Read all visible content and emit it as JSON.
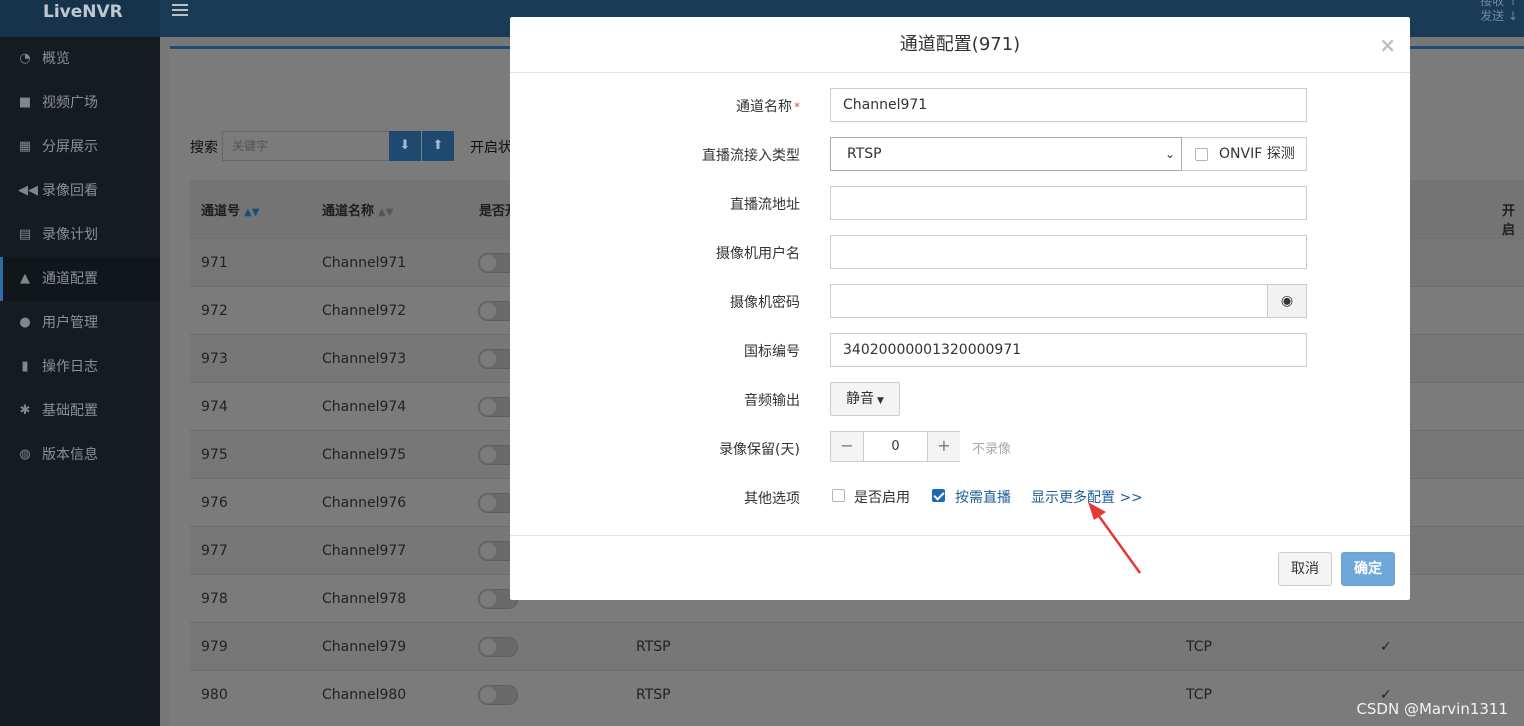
{
  "app": {
    "brand": "LiveNVR",
    "net_recv": "接收",
    "net_send": "发送"
  },
  "sidebar": {
    "items": [
      {
        "label": "概览",
        "icon": "dashboard-icon"
      },
      {
        "label": "视频广场",
        "icon": "video-camera-icon"
      },
      {
        "label": "分屏展示",
        "icon": "grid-icon"
      },
      {
        "label": "录像回看",
        "icon": "rewind-icon"
      },
      {
        "label": "录像计划",
        "icon": "calendar-icon"
      },
      {
        "label": "通道配置",
        "icon": "road-icon",
        "active": true
      },
      {
        "label": "用户管理",
        "icon": "users-icon"
      },
      {
        "label": "操作日志",
        "icon": "file-icon"
      },
      {
        "label": "基础配置",
        "icon": "gears-icon"
      },
      {
        "label": "版本信息",
        "icon": "globe-icon"
      }
    ]
  },
  "toolbar": {
    "search_label": "搜索",
    "search_placeholder": "关键字",
    "filter_label": "开启状态"
  },
  "table": {
    "headers": [
      "通道号",
      "通道名称",
      "是否开",
      "开启"
    ],
    "rows": [
      {
        "id": "971",
        "name": "Channel971",
        "proto": "",
        "transport": "",
        "check": ""
      },
      {
        "id": "972",
        "name": "Channel972",
        "proto": "",
        "transport": "",
        "check": ""
      },
      {
        "id": "973",
        "name": "Channel973",
        "proto": "",
        "transport": "",
        "check": ""
      },
      {
        "id": "974",
        "name": "Channel974",
        "proto": "",
        "transport": "",
        "check": ""
      },
      {
        "id": "975",
        "name": "Channel975",
        "proto": "",
        "transport": "",
        "check": ""
      },
      {
        "id": "976",
        "name": "Channel976",
        "proto": "",
        "transport": "",
        "check": ""
      },
      {
        "id": "977",
        "name": "Channel977",
        "proto": "",
        "transport": "",
        "check": ""
      },
      {
        "id": "978",
        "name": "Channel978",
        "proto": "",
        "transport": "",
        "check": ""
      },
      {
        "id": "979",
        "name": "Channel979",
        "proto": "RTSP",
        "transport": "TCP",
        "check": "✓"
      },
      {
        "id": "980",
        "name": "Channel980",
        "proto": "RTSP",
        "transport": "TCP",
        "check": "✓"
      }
    ]
  },
  "modal": {
    "title": "通道配置(971)",
    "close": "×",
    "fields": {
      "channel_name": {
        "label": "通道名称",
        "required_mark": "*",
        "value": "Channel971"
      },
      "stream_type": {
        "label": "直播流接入类型",
        "value": "RTSP",
        "onvif_label": "ONVIF 探测",
        "onvif_checked": false
      },
      "stream_url": {
        "label": "直播流地址",
        "value": ""
      },
      "camera_user": {
        "label": "摄像机用户名",
        "value": ""
      },
      "camera_password": {
        "label": "摄像机密码",
        "value": ""
      },
      "gb_code": {
        "label": "国标编号",
        "value": "34020000001320000971"
      },
      "audio_output": {
        "label": "音频输出",
        "value": "静音"
      },
      "record_keep": {
        "label": "录像保留(天)",
        "value": "0",
        "minus": "−",
        "plus": "+",
        "hint": "不录像"
      },
      "other_options": {
        "label": "其他选项",
        "enabled_label": "是否启用",
        "enabled_checked": false,
        "on_demand_label": "按需直播",
        "on_demand_checked": true,
        "more_link": "显示更多配置 >>"
      }
    },
    "cancel_label": "取消",
    "ok_label": "确定"
  },
  "watermark": "CSDN @Marvin1311",
  "colors": {
    "primary": "#1f68b7",
    "annotation_arrow": "#e53935",
    "required": "#d9534f"
  }
}
